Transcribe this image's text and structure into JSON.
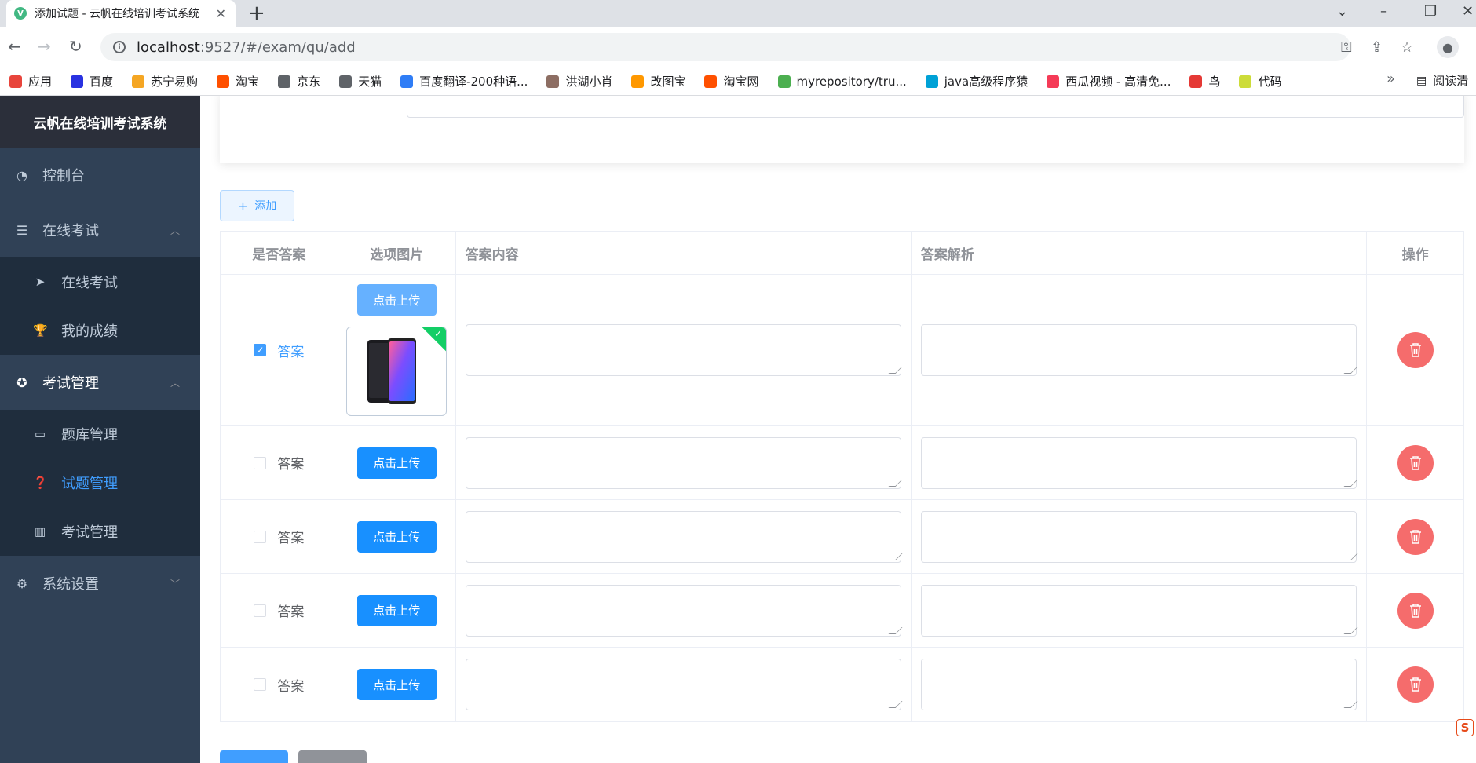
{
  "browser": {
    "tab_title": "添加试题 - 云帆在线培训考试系统",
    "tab_favicon": "V",
    "url_host": "localhost",
    "url_rest": ":9527/#/exam/qu/add",
    "bookmarks": [
      {
        "label": "应用",
        "color": "#e8453c"
      },
      {
        "label": "百度",
        "color": "#2932e1"
      },
      {
        "label": "苏宁易购",
        "color": "#f5a623"
      },
      {
        "label": "淘宝",
        "color": "#ff5000"
      },
      {
        "label": "京东",
        "color": "#5f6368"
      },
      {
        "label": "天猫",
        "color": "#5f6368"
      },
      {
        "label": "百度翻译-200种语...",
        "color": "#2f7df6"
      },
      {
        "label": "洪湖小肖",
        "color": "#8d6e63"
      },
      {
        "label": "改图宝",
        "color": "#ff9800"
      },
      {
        "label": "淘宝网",
        "color": "#ff5000"
      },
      {
        "label": "myrepository/tru...",
        "color": "#4caf50"
      },
      {
        "label": "java高级程序猿",
        "color": "#00a1d6"
      },
      {
        "label": "西瓜视频 - 高清免...",
        "color": "#f53b57"
      },
      {
        "label": "鸟",
        "color": "#e53935"
      },
      {
        "label": "代码",
        "color": "#cddc39"
      }
    ],
    "bookmarks_more": "»",
    "reader_mode": "阅读清"
  },
  "sidebar": {
    "logo": "云帆在线培训考试系统",
    "items": [
      {
        "label": "控制台",
        "icon": "dashboard-icon"
      },
      {
        "label": "在线考试",
        "icon": "list-icon",
        "children": [
          {
            "label": "在线考试",
            "icon": "send-icon"
          },
          {
            "label": "我的成绩",
            "icon": "trophy-icon"
          }
        ]
      },
      {
        "label": "考试管理",
        "icon": "lifebuoy-icon",
        "children": [
          {
            "label": "题库管理",
            "icon": "monitor-icon"
          },
          {
            "label": "试题管理",
            "icon": "question-icon",
            "active": true
          },
          {
            "label": "考试管理",
            "icon": "book-icon"
          }
        ]
      },
      {
        "label": "系统设置",
        "icon": "gear-icon"
      }
    ]
  },
  "main": {
    "add_button": "添加",
    "table": {
      "headers": [
        "是否答案",
        "选项图片",
        "答案内容",
        "答案解析",
        "操作"
      ],
      "rows": [
        {
          "checked": true,
          "answer_label": "答案",
          "upload_label": "点击上传",
          "has_image": true
        },
        {
          "checked": false,
          "answer_label": "答案",
          "upload_label": "点击上传",
          "has_image": false
        },
        {
          "checked": false,
          "answer_label": "答案",
          "upload_label": "点击上传",
          "has_image": false
        },
        {
          "checked": false,
          "answer_label": "答案",
          "upload_label": "点击上传",
          "has_image": false
        },
        {
          "checked": false,
          "answer_label": "答案",
          "upload_label": "点击上传",
          "has_image": false
        }
      ]
    }
  },
  "colors": {
    "sidebar_bg": "#304156",
    "primary": "#1890ff",
    "danger": "#f56c6c",
    "success": "#13ce66"
  }
}
